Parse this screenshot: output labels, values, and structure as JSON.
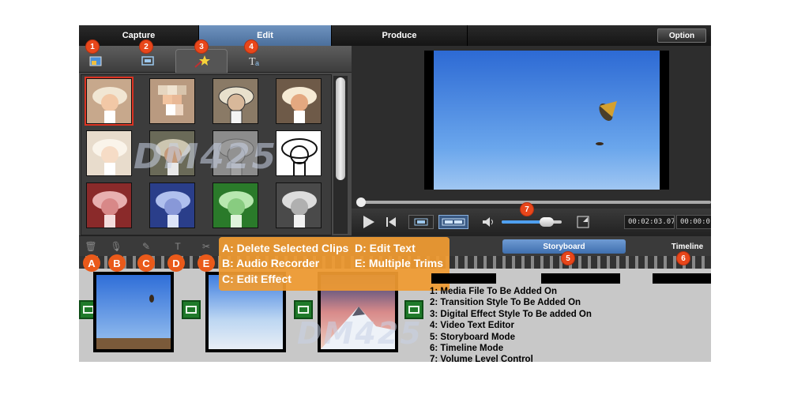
{
  "tabs": [
    {
      "label": "Capture",
      "active": false
    },
    {
      "label": "Edit",
      "active": true
    },
    {
      "label": "Produce",
      "active": false
    }
  ],
  "option_label": "Option",
  "panel_tabs": [
    {
      "name": "media-file-tab",
      "icon": "media-file-icon",
      "badge": "1"
    },
    {
      "name": "transition-tab",
      "icon": "transition-icon",
      "badge": "2"
    },
    {
      "name": "effect-tab",
      "icon": "magic-wand-icon",
      "badge": "3",
      "active": true
    },
    {
      "name": "text-tab",
      "icon": "text-editor-icon",
      "badge": "4"
    }
  ],
  "effect_styles": [
    "normal",
    "pixelate",
    "sketch",
    "emboss-sharp",
    "soft-light",
    "noise",
    "relief",
    "line-art",
    "red-tint",
    "blue-tint",
    "green-tint",
    "grayscale"
  ],
  "player": {
    "volume_badge": "7",
    "volume_level": 0.75,
    "time_current": "00:02:03.07",
    "time_total": "00:00:0"
  },
  "edit_tools": [
    {
      "name": "delete-button",
      "icon": "trash-icon",
      "glyph": "🗑",
      "letter": "A"
    },
    {
      "name": "audio-recorder-button",
      "icon": "microphone-icon",
      "glyph": "🎙",
      "letter": "B"
    },
    {
      "name": "edit-effect-button",
      "icon": "effect-icon",
      "glyph": "✎",
      "letter": "C"
    },
    {
      "name": "edit-text-button",
      "icon": "text-icon",
      "glyph": "T",
      "letter": "D"
    },
    {
      "name": "multiple-trims-button",
      "icon": "scissors-icon",
      "glyph": "✂",
      "letter": "E"
    }
  ],
  "modes": {
    "storyboard": "Storyboard",
    "timeline": "Timeline",
    "storyboard_badge": "5",
    "timeline_badge": "6"
  },
  "callout": {
    "a": "A: Delete Selected Clips",
    "b": "B: Audio Recorder",
    "c": "C: Edit Effect",
    "d": "D: Edit Text",
    "e": "E: Multiple Trims"
  },
  "legend": [
    "1: Media File To Be Added On",
    "2: Transition Style To Be Added On",
    "3: Digital Effect Style To Be added On",
    "4: Video Text Editor",
    "5: Storyboard Mode",
    "6: Timeline Mode",
    "7: Volume Level Control"
  ],
  "watermark": "DM425",
  "colors": {
    "accent_blue": "#4b6f9c",
    "badge_orange": "#e8471b",
    "callout_orange": "#f09b32",
    "transition_green": "#1f7a2a"
  }
}
